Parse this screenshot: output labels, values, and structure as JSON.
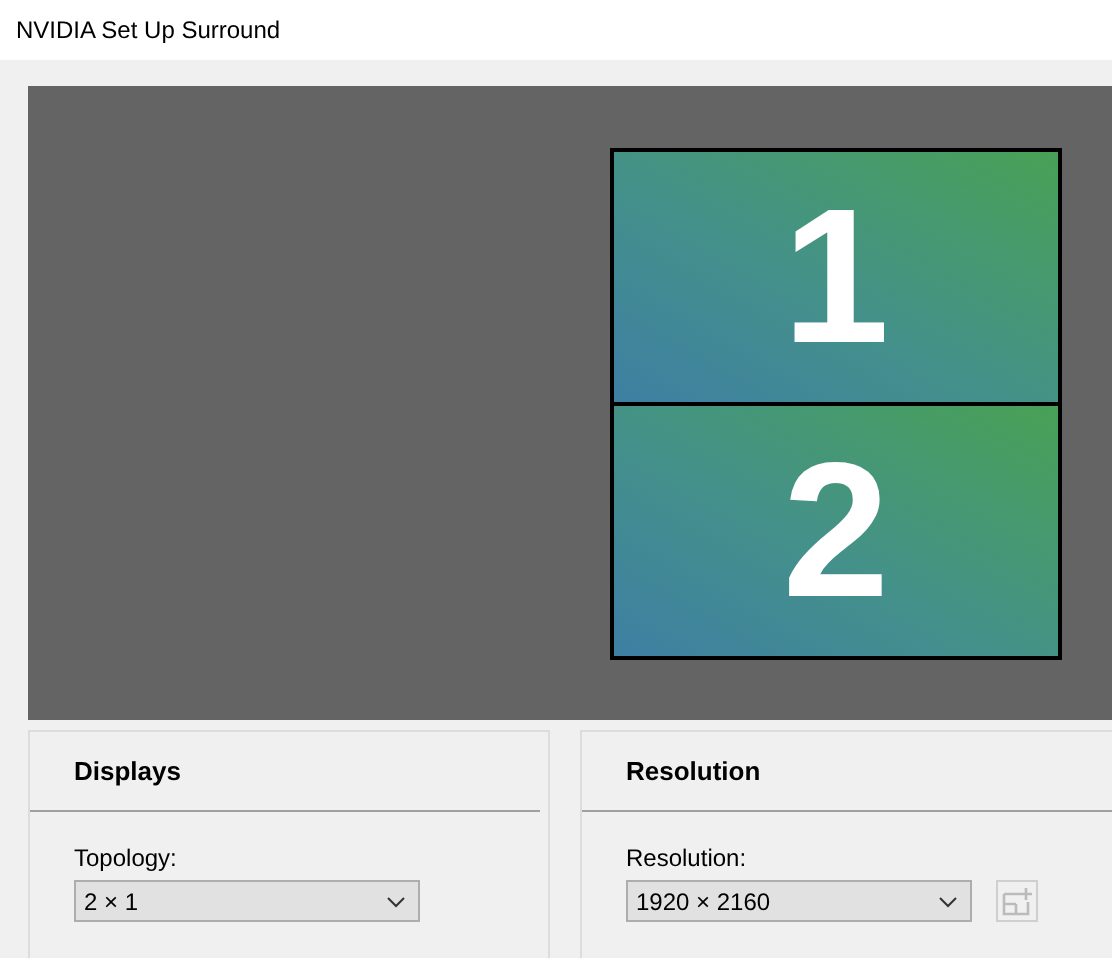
{
  "window": {
    "title": "NVIDIA Set Up Surround"
  },
  "displays_preview": [
    {
      "label": "1"
    },
    {
      "label": "2"
    }
  ],
  "panels": [
    {
      "title": "Displays",
      "field_label": "Topology:",
      "value": "2 × 1",
      "has_icon_button": false
    },
    {
      "title": "Resolution",
      "field_label": "Resolution:",
      "value": "1920 × 2160",
      "has_icon_button": true
    }
  ]
}
